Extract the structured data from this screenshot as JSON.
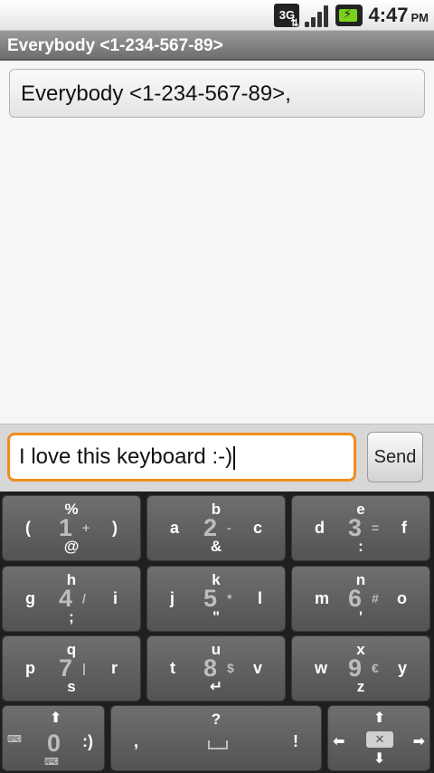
{
  "status_bar": {
    "network": "3G",
    "time": "4:47",
    "ampm": "PM"
  },
  "title_bar": {
    "title": "Everybody  <1-234-567-89>"
  },
  "recipients": {
    "value": "Everybody  <1-234-567-89>,"
  },
  "compose": {
    "message": "I love this keyboard :-)",
    "send_label": "Send"
  },
  "keyboard": {
    "keys": [
      {
        "top": "%",
        "left": "(",
        "num": "1",
        "sym": "+",
        "right": ")",
        "bottom": "@"
      },
      {
        "top": "b",
        "left": "a",
        "num": "2",
        "sym": "-",
        "right": "c",
        "bottom": "&"
      },
      {
        "top": "e",
        "left": "d",
        "num": "3",
        "sym": "=",
        "right": "f",
        "bottom": ":"
      },
      {
        "top": "h",
        "left": "g",
        "num": "4",
        "sym": "/",
        "right": "i",
        "bottom": ";"
      },
      {
        "top": "k",
        "left": "j",
        "num": "5",
        "sym": "*",
        "right": "l",
        "bottom": "\""
      },
      {
        "top": "n",
        "left": "m",
        "num": "6",
        "sym": "#",
        "right": "o",
        "bottom": "'"
      },
      {
        "top": "q",
        "left": "p",
        "num": "7",
        "sym": "|",
        "right": "r",
        "bottom": "s"
      },
      {
        "top": "u",
        "left": "t",
        "num": "8",
        "sym": "$",
        "right": "v",
        "bottom": "↵"
      },
      {
        "top": "x",
        "left": "w",
        "num": "9",
        "sym": "€",
        "right": "y",
        "bottom": "z"
      }
    ],
    "zero_key": {
      "num": "0",
      "right": ":)"
    },
    "space_key": {
      "top": "?",
      "left": ",",
      "right": "!"
    }
  }
}
